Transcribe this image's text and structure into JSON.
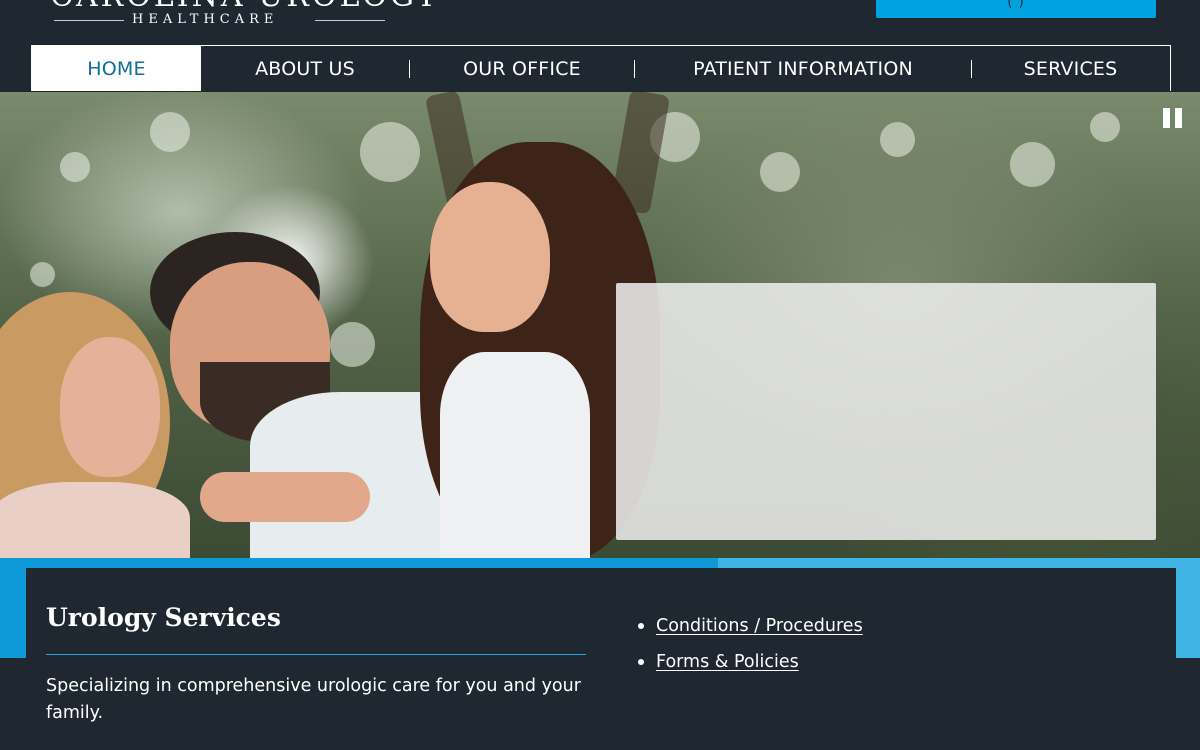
{
  "header": {
    "logo": {
      "name": "CAROLINA UROLOGY",
      "subtitle": "HEALTHCARE"
    },
    "phone_button": {
      "label": "( )"
    }
  },
  "nav": {
    "items": [
      {
        "label": "HOME",
        "active": true
      },
      {
        "label": "ABOUT US",
        "active": false
      },
      {
        "label": "OUR OFFICE",
        "active": false
      },
      {
        "label": "PATIENT INFORMATION",
        "active": false
      },
      {
        "label": "SERVICES",
        "active": false
      }
    ]
  },
  "hero": {
    "pause_icon": "pause-icon"
  },
  "panel": {
    "title": "Urology Services",
    "description": "Specializing in comprehensive urologic care for you and your family.",
    "links": [
      {
        "label": "Conditions / Procedures"
      },
      {
        "label": "Forms & Policies"
      }
    ]
  },
  "colors": {
    "background": "#1f2731",
    "accent_blue": "#0f99d8",
    "accent_light_blue": "#41b4e6",
    "active_nav_text": "#0f6e9a"
  }
}
